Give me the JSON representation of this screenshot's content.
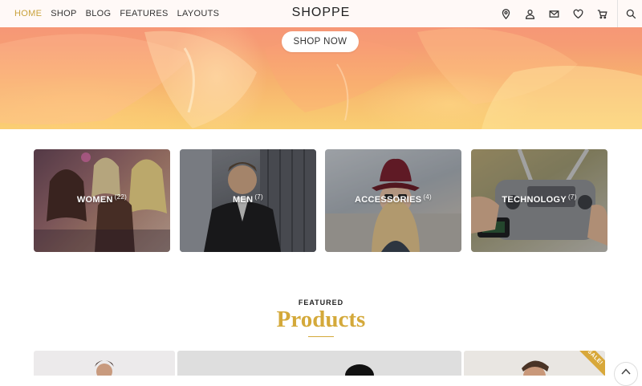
{
  "nav": {
    "links": [
      {
        "label": "HOME",
        "active": true
      },
      {
        "label": "SHOP",
        "active": false
      },
      {
        "label": "BLOG",
        "active": false
      },
      {
        "label": "FEATURES",
        "active": false
      },
      {
        "label": "LAYOUTS",
        "active": false
      }
    ],
    "brand": "SHOPPE",
    "icons": [
      "location-pin-icon",
      "user-icon",
      "mail-icon",
      "heart-icon",
      "cart-icon",
      "search-icon"
    ]
  },
  "hero": {
    "cta_label": "SHOP NOW"
  },
  "categories": [
    {
      "name": "WOMEN",
      "count": "(22)"
    },
    {
      "name": "MEN",
      "count": "(7)"
    },
    {
      "name": "ACCESSORIES",
      "count": "(4)"
    },
    {
      "name": "TECHNOLOGY",
      "count": "(7)"
    }
  ],
  "featured": {
    "kicker": "FEATURED",
    "title": "Products"
  },
  "products": {
    "sale_badge": "SALE!"
  },
  "colors": {
    "accent": "#d4a93a",
    "nav_active": "#c9a23c",
    "text": "#333333"
  }
}
